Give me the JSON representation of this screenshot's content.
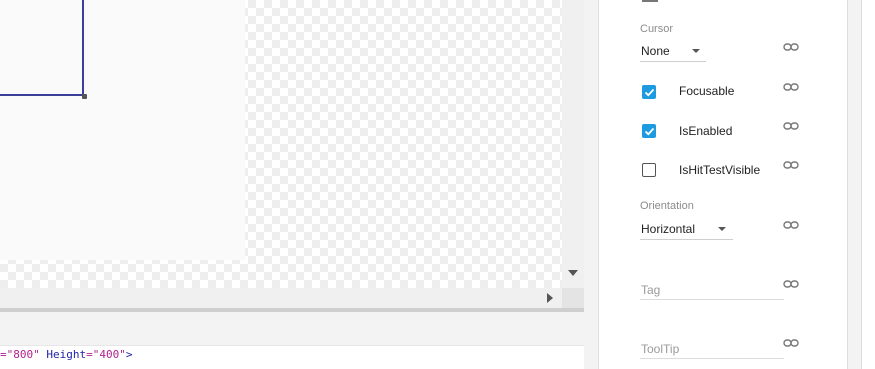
{
  "code": {
    "frag1": "=\"800\"",
    "frag2": " Height",
    "frag3": "=\"400\"",
    "frag4": ">"
  },
  "properties": {
    "cursor": {
      "label": "Cursor",
      "value": "None"
    },
    "focusable": {
      "label": "Focusable",
      "checked": true
    },
    "is_enabled": {
      "label": "IsEnabled",
      "checked": true
    },
    "is_hit_test_visible": {
      "label": "IsHitTestVisible",
      "checked": false
    },
    "orientation": {
      "label": "Orientation",
      "value": "Horizontal"
    },
    "tag": {
      "placeholder": "Tag"
    },
    "tooltip": {
      "placeholder": "ToolTip"
    }
  },
  "icons": {
    "link": "link-icon",
    "checkmark": "check-icon",
    "dropdown": "caret-down-icon"
  },
  "colors": {
    "accent": "#1e9be0",
    "selection": "#3b3f9a"
  }
}
